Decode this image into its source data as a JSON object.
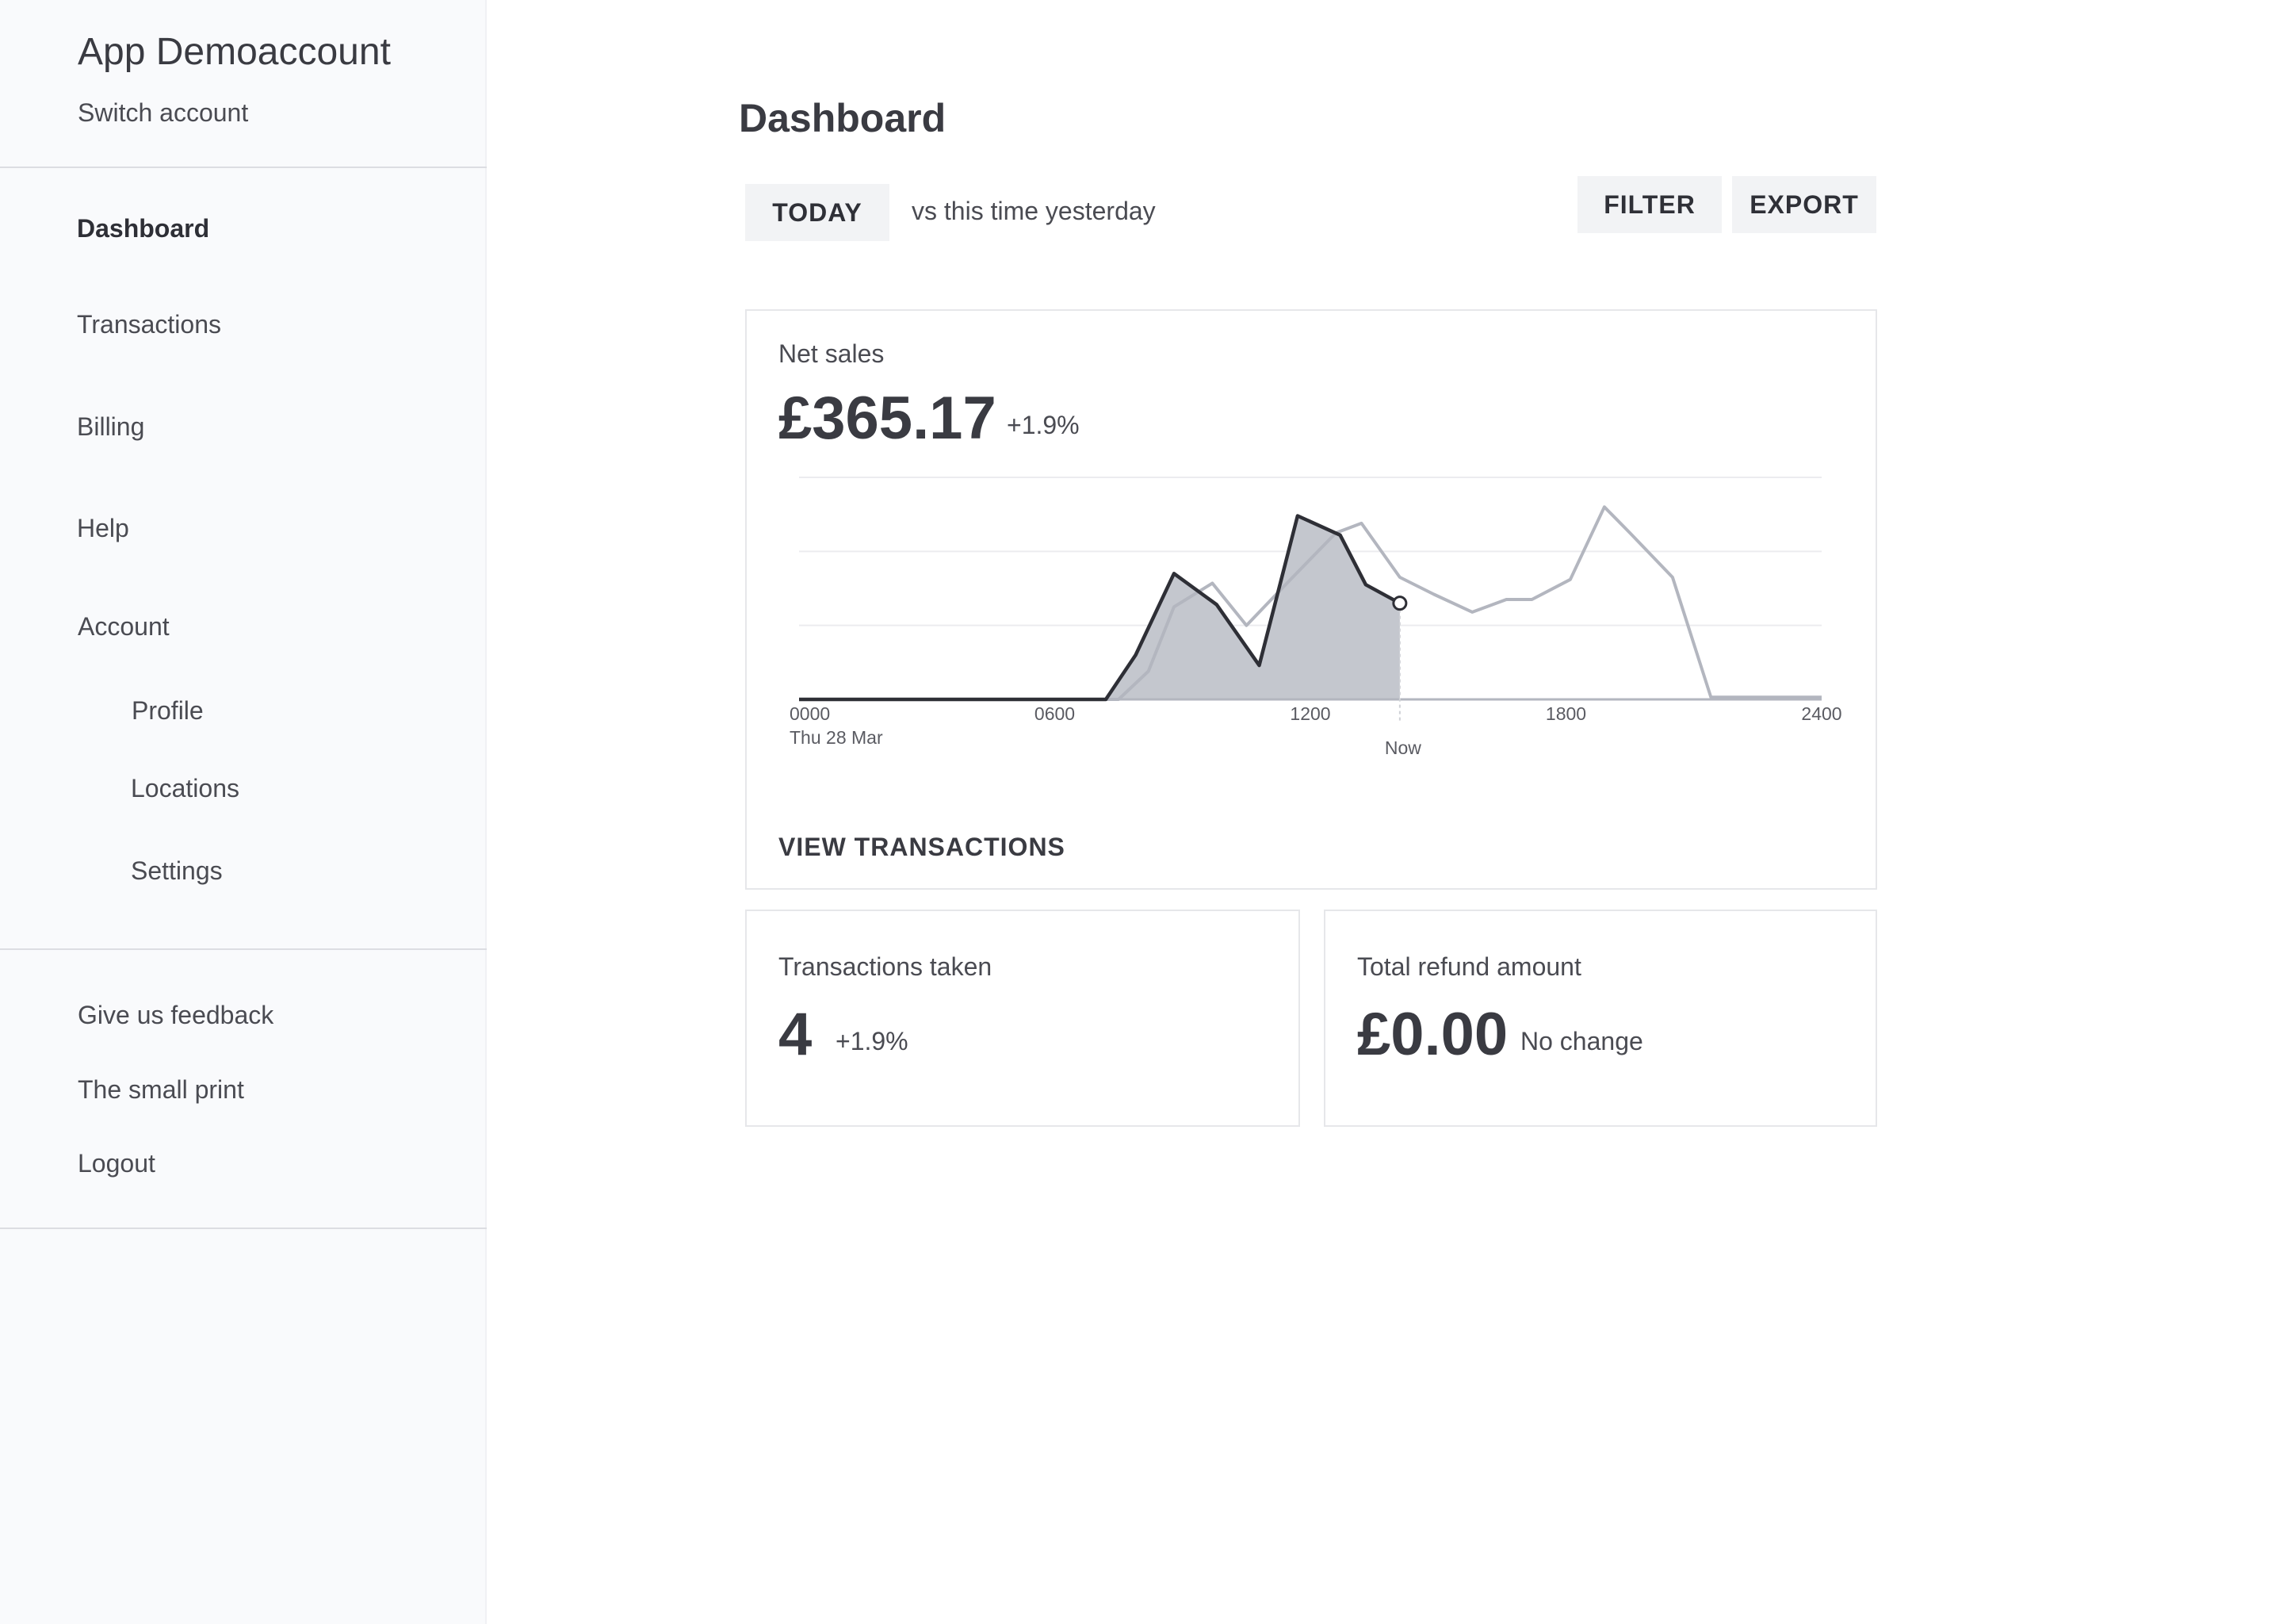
{
  "sidebar": {
    "account_name": "App Demoaccount",
    "switch_account": "Switch account",
    "nav": {
      "dashboard": "Dashboard",
      "transactions": "Transactions",
      "billing": "Billing",
      "help": "Help",
      "account": "Account",
      "profile": "Profile",
      "locations": "Locations",
      "settings": "Settings"
    },
    "footer": {
      "feedback": "Give us feedback",
      "small_print": "The small print",
      "logout": "Logout"
    }
  },
  "main": {
    "title": "Dashboard",
    "period_button": "TODAY",
    "compare_text": "vs this time yesterday",
    "filter_button": "FILTER",
    "export_button": "EXPORT"
  },
  "net_sales": {
    "label": "Net sales",
    "value": "£365.17",
    "change": "+1.9%",
    "view_transactions": "VIEW TRANSACTIONS"
  },
  "transactions_taken": {
    "label": "Transactions taken",
    "value": "4",
    "change": "+1.9%"
  },
  "refund": {
    "label": "Total refund amount",
    "value": "£0.00",
    "change": "No change"
  },
  "colors": {
    "today_line": "#2e2f36",
    "today_fill": "#c4c7ce",
    "yesterday_line": "#b3b6bf",
    "grid": "#ececef"
  },
  "chart_data": {
    "type": "line",
    "x_unit": "hour of day",
    "xlim": [
      0,
      24
    ],
    "ylim": [
      0,
      3
    ],
    "grid": true,
    "x_ticks": [
      {
        "value": 0,
        "label": "0000"
      },
      {
        "value": 6,
        "label": "0600"
      },
      {
        "value": 12,
        "label": "1200"
      },
      {
        "value": 18,
        "label": "1800"
      },
      {
        "value": 24,
        "label": "2400"
      }
    ],
    "date_label": "Thu 28 Mar",
    "now_label": "Now",
    "now_x": 14.1,
    "series": [
      {
        "key": "today",
        "x": [
          0,
          7.2,
          7.9,
          8.8,
          9.8,
          10.8,
          11.7,
          12.7,
          13.3,
          14.1
        ],
        "y": [
          0,
          0,
          0.6,
          1.7,
          1.28,
          0.46,
          2.48,
          2.22,
          1.55,
          1.3
        ],
        "filled": true
      },
      {
        "key": "yesterday",
        "x": [
          0,
          7.5,
          8.2,
          8.8,
          9.7,
          10.5,
          11.5,
          12.6,
          13.2,
          14.1,
          14.9,
          15.8,
          16.6,
          17.2,
          18.1,
          18.9,
          19.5,
          20.5,
          21.4,
          22.2,
          23.2,
          24
        ],
        "y": [
          0,
          0,
          0.38,
          1.25,
          1.57,
          1.0,
          1.6,
          2.25,
          2.38,
          1.65,
          1.42,
          1.18,
          1.35,
          1.35,
          1.62,
          2.6,
          2.25,
          1.65,
          0.03,
          0.03,
          0.03,
          0.03
        ]
      }
    ]
  }
}
